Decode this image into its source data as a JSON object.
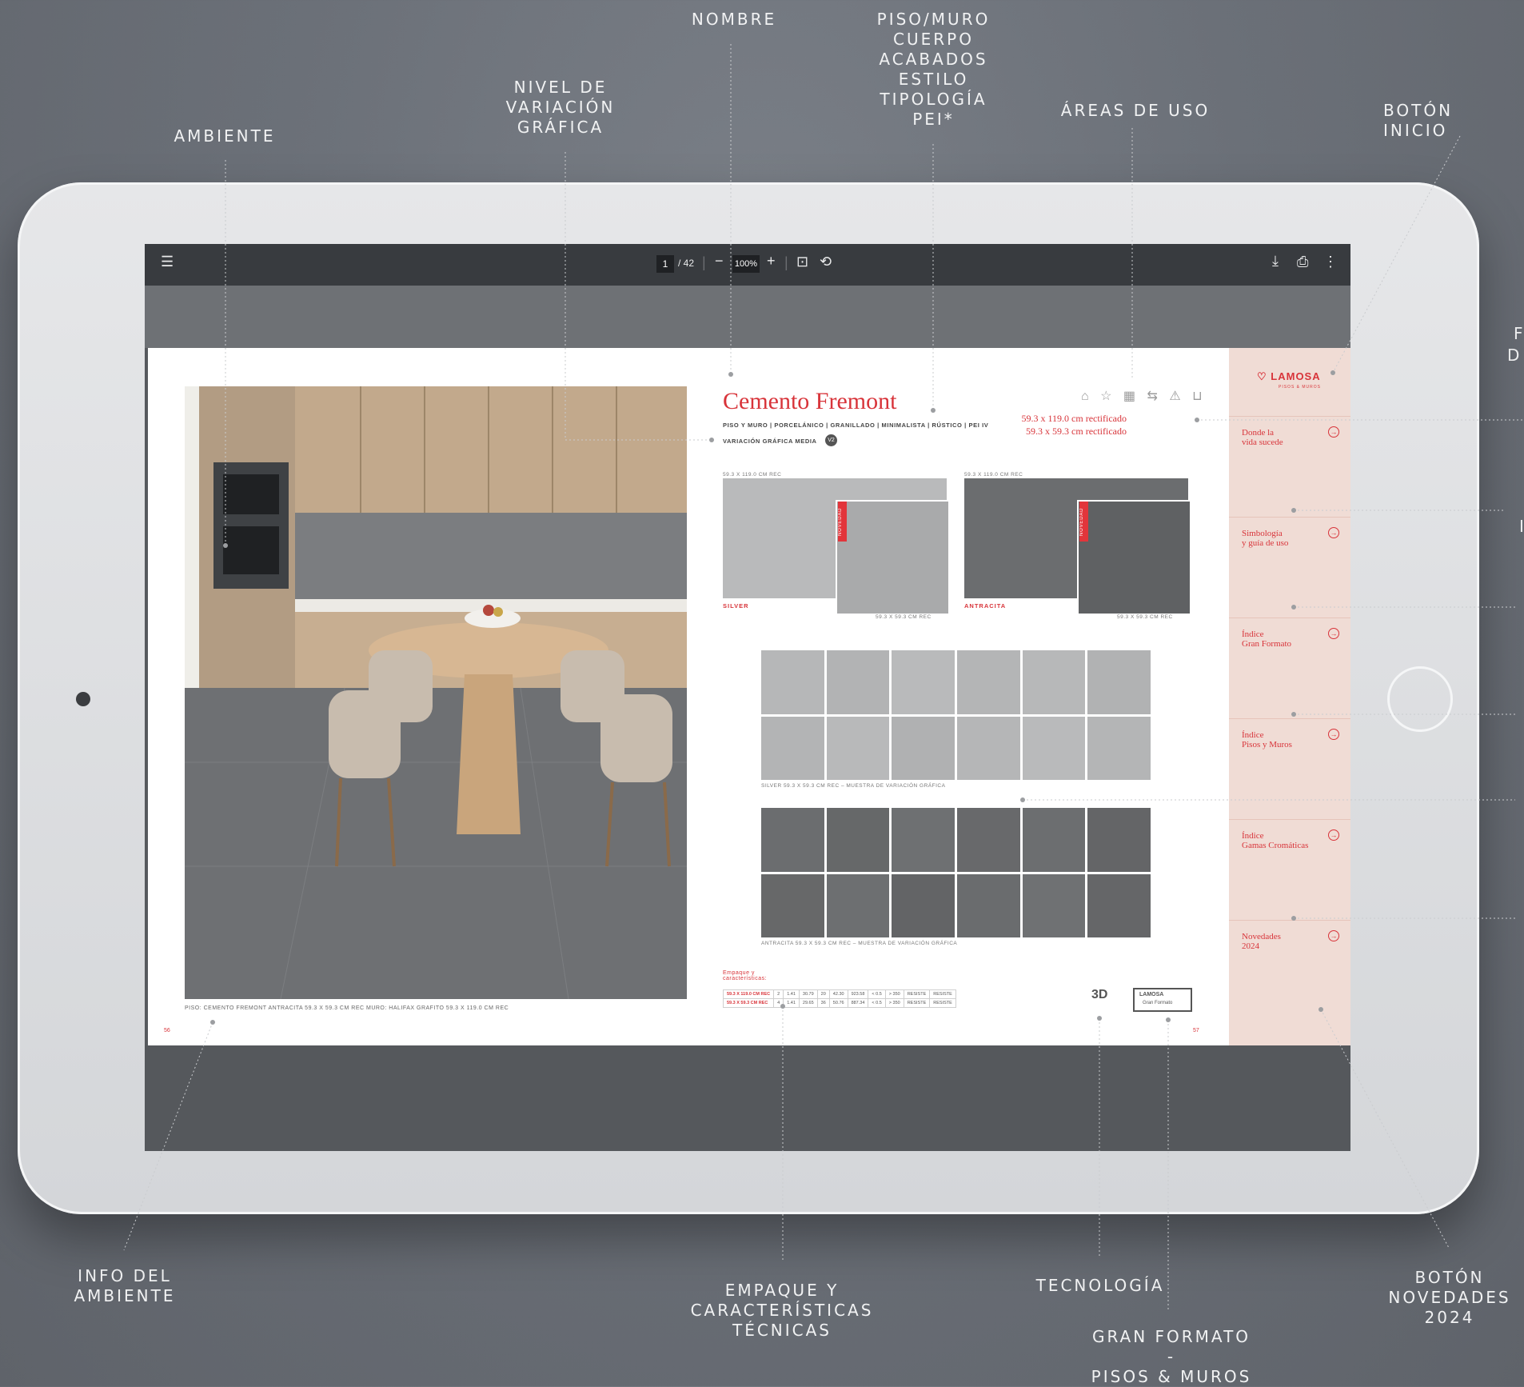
{
  "callouts": {
    "nombre": "NOMBRE",
    "piso_muro": "PISO/MURO\nCUERPO\nACABADOS\nESTILO\nTIPOLOGÍA\nPEI*",
    "nivel_variacion": "NIVEL DE\nVARIACIÓN\nGRÁFICA",
    "ambiente": "AMBIENTE",
    "areas_uso": "ÁREAS DE USO",
    "boton_inicio": "BOTÓN INICIO",
    "info_ambiente": "INFO DEL\nAMBIENTE",
    "empaque": "EMPAQUE Y\nCARACTERÍSTICAS\nTÉCNICAS",
    "tecnologia": "TECNOLOGÍA",
    "gran_formato": "GRAN FORMATO\n-\nPISOS & MUROS",
    "boton_novedades": "BOTÓN\nNOVEDADES\n2024",
    "side_f": "F",
    "side_d": "D",
    "side_i": "I"
  },
  "viewer": {
    "menu_icon": "hamburger-icon",
    "page_current": "1",
    "page_total": "/ 42",
    "zoom_out": "−",
    "zoom_level": "100%",
    "zoom_in": "+",
    "fit_icon": "fit-page-icon",
    "rotate_icon": "rotate-icon",
    "download_icon": "download-icon",
    "print_icon": "print-icon",
    "more_icon": "more-vertical-icon"
  },
  "catalog": {
    "title": "Cemento Fremont",
    "subtitle": "PISO Y MURO | PORCELÁNICO | GRANILLADO | MINIMALISTA | RÚSTICO | PEI IV",
    "variation": "VARIACIÓN GRÁFICA MEDIA",
    "variation_badge": "V2",
    "sizes": [
      "59.3 x 119.0 cm rectificado",
      "59.3 x 59.3 cm rectificado"
    ],
    "usage_icons": "⌂ ☆ ▦ ⇆ ⚠ ⊔",
    "photo_caption": "PISO: CEMENTO FREMONT ANTRACITA 59.3 X 59.3 CM REC   MURO: HALIFAX GRAFITO 59.3 X 119.0 CM REC",
    "page_left": "56",
    "page_right": "57",
    "tiles": [
      {
        "name": "SILVER",
        "size_top": "59.3 X 119.0 CM REC",
        "size_bottom": "59.3 X 59.3 CM REC",
        "badge": "NOVEDAD",
        "color": "#b9babb"
      },
      {
        "name": "ANTRACITA",
        "size_top": "59.3 X 119.0 CM REC",
        "size_bottom": "59.3 X 59.3 CM REC",
        "badge": "NOVEDAD",
        "color": "#6b6d6f"
      }
    ],
    "sample_silver": "SILVER 59.3 X 59.3 CM REC – MUESTRA DE VARIACIÓN GRÁFICA",
    "sample_antracita": "ANTRACITA 59.3 X 59.3 CM REC – MUESTRA DE VARIACIÓN GRÁFICA",
    "packing_label": "Empaque y características:",
    "packing_rows": [
      [
        "59.3 X 119.0 CM REC",
        "2",
        "1.41",
        "30.79",
        "20",
        "42.30",
        "923.58",
        "< 0.5",
        "> 350",
        "RESISTE",
        "RESISTE"
      ],
      [
        "59.3 X 59.3 CM REC",
        "4",
        "1.41",
        "29.65",
        "36",
        "50.76",
        "887.34",
        "< 0.5",
        "> 350",
        "RESISTE",
        "RESISTE"
      ]
    ],
    "tech_badge": "3D",
    "brand_badge": "LAMOSA",
    "brand_badge_sub": "Gran Formato"
  },
  "sidebar": {
    "logo": "LAMOSA",
    "logo_sub": "PISOS & MUROS",
    "items": [
      {
        "label": "Donde la\nvida sucede",
        "arrow": "→"
      },
      {
        "label": "Simbología\ny guía de uso",
        "arrow": "→"
      },
      {
        "label": "Índice\nGran Formato",
        "arrow": "→"
      },
      {
        "label": "Índice\nPisos y Muros",
        "arrow": "→"
      },
      {
        "label": "Índice\nGamas Cromáticas",
        "arrow": "→"
      },
      {
        "label": "Novedades\n2024",
        "arrow": "→"
      }
    ]
  }
}
